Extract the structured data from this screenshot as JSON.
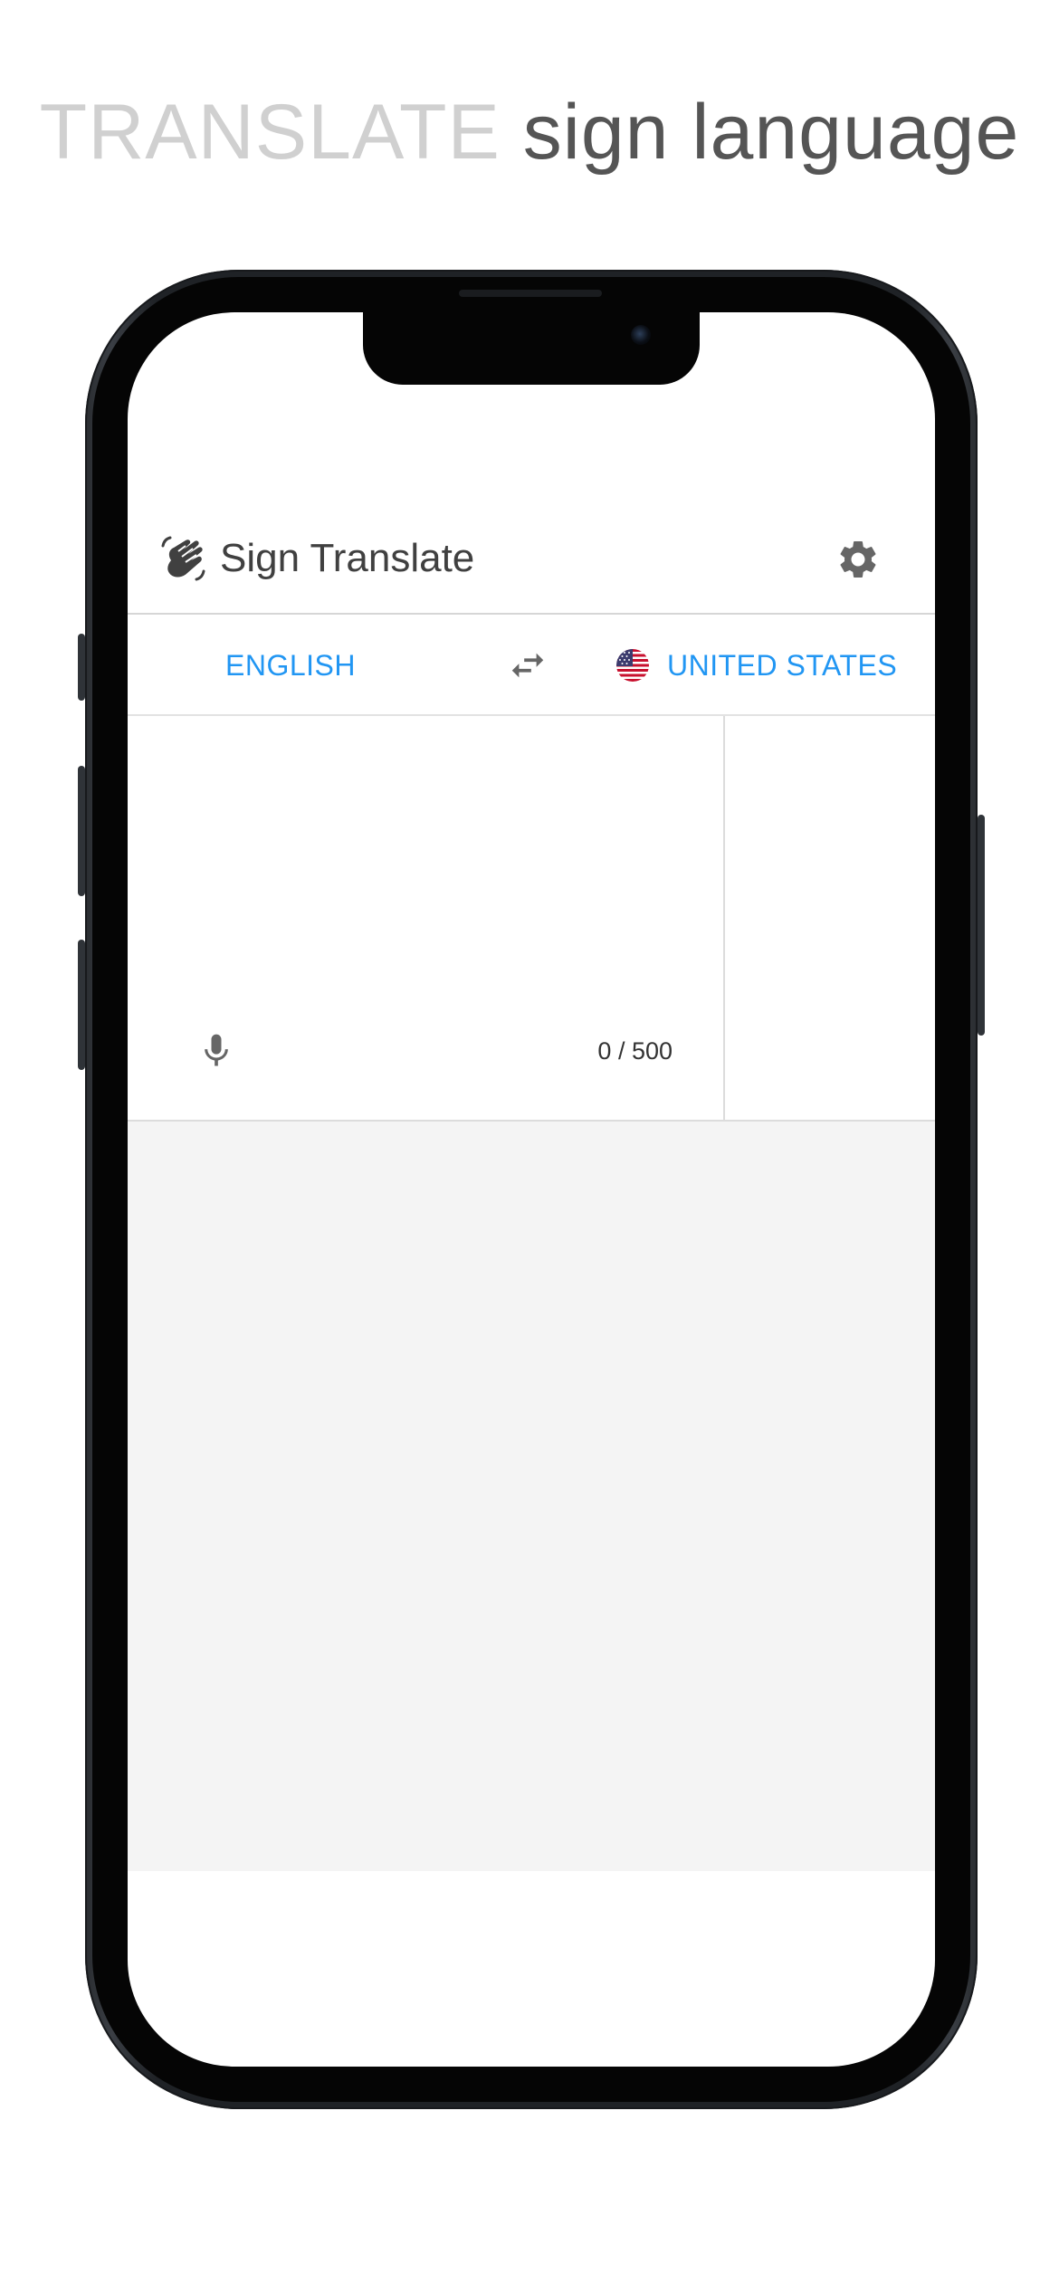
{
  "headline": {
    "light": "TRANSLATE",
    "dark": "sign language"
  },
  "app": {
    "title": "Sign Translate",
    "logo_icon": "waving-hand-icon",
    "settings_icon": "gear-icon"
  },
  "languages": {
    "source": "ENGLISH",
    "target": "UNITED STATES",
    "target_flag": "us-flag-icon",
    "swap_icon": "swap-arrows-icon"
  },
  "input": {
    "value": "",
    "placeholder": "",
    "char_count": "0 / 500",
    "mic_icon": "microphone-icon"
  },
  "colors": {
    "accent": "#2196f3",
    "icon": "#666666",
    "video_bg": "#f4f4f4"
  }
}
